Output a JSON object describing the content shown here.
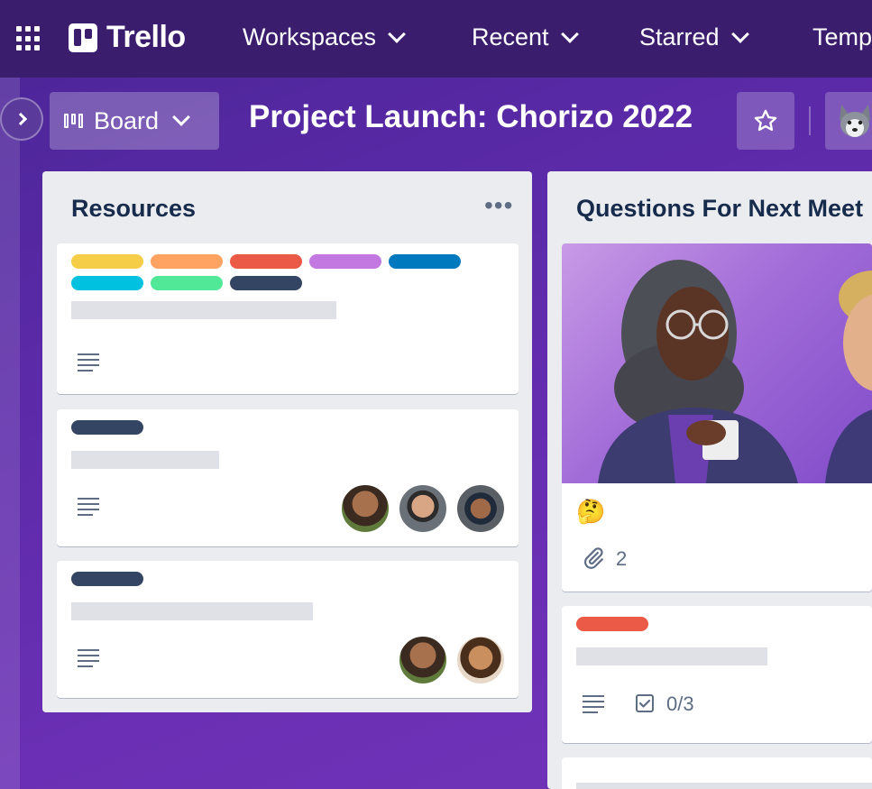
{
  "nav": {
    "logo_text": "Trello",
    "items": [
      {
        "label": "Workspaces"
      },
      {
        "label": "Recent"
      },
      {
        "label": "Starred"
      },
      {
        "label": "Temp"
      }
    ]
  },
  "board_header": {
    "view_label": "Board",
    "title": "Project Launch: Chorizo 2022"
  },
  "lists": [
    {
      "title": "Resources",
      "more": "•••",
      "cards": [
        {
          "labels": [
            "yellow",
            "orange",
            "red",
            "purple",
            "blue",
            "sky",
            "green",
            "navy"
          ],
          "has_description": true
        },
        {
          "labels": [
            "navy"
          ],
          "has_description": true,
          "members": 3
        },
        {
          "labels": [
            "navy"
          ],
          "has_description": true,
          "members": 2
        }
      ]
    },
    {
      "title": "Questions For Next Meet",
      "cards": [
        {
          "cover": "illustration",
          "emoji": "🤔",
          "attachments": "2"
        },
        {
          "labels": [
            "red"
          ],
          "has_description": true,
          "checklist": "0/3"
        },
        {}
      ]
    }
  ],
  "colors": {
    "nav_bg": "#3b1d6e",
    "list_bg": "#ebecf0",
    "label_yellow": "#f5cd47",
    "label_orange": "#fea362",
    "label_red": "#eb5a46",
    "label_purple": "#c377e0",
    "label_blue": "#0079bf",
    "label_sky": "#00c2e0",
    "label_green": "#51e898",
    "label_navy": "#344563"
  },
  "icons": [
    "apps-grid-icon",
    "trello-logo-icon",
    "chevron-down-icon",
    "chevron-right-icon",
    "board-view-icon",
    "star-icon",
    "description-icon",
    "attachment-icon",
    "checklist-icon"
  ]
}
